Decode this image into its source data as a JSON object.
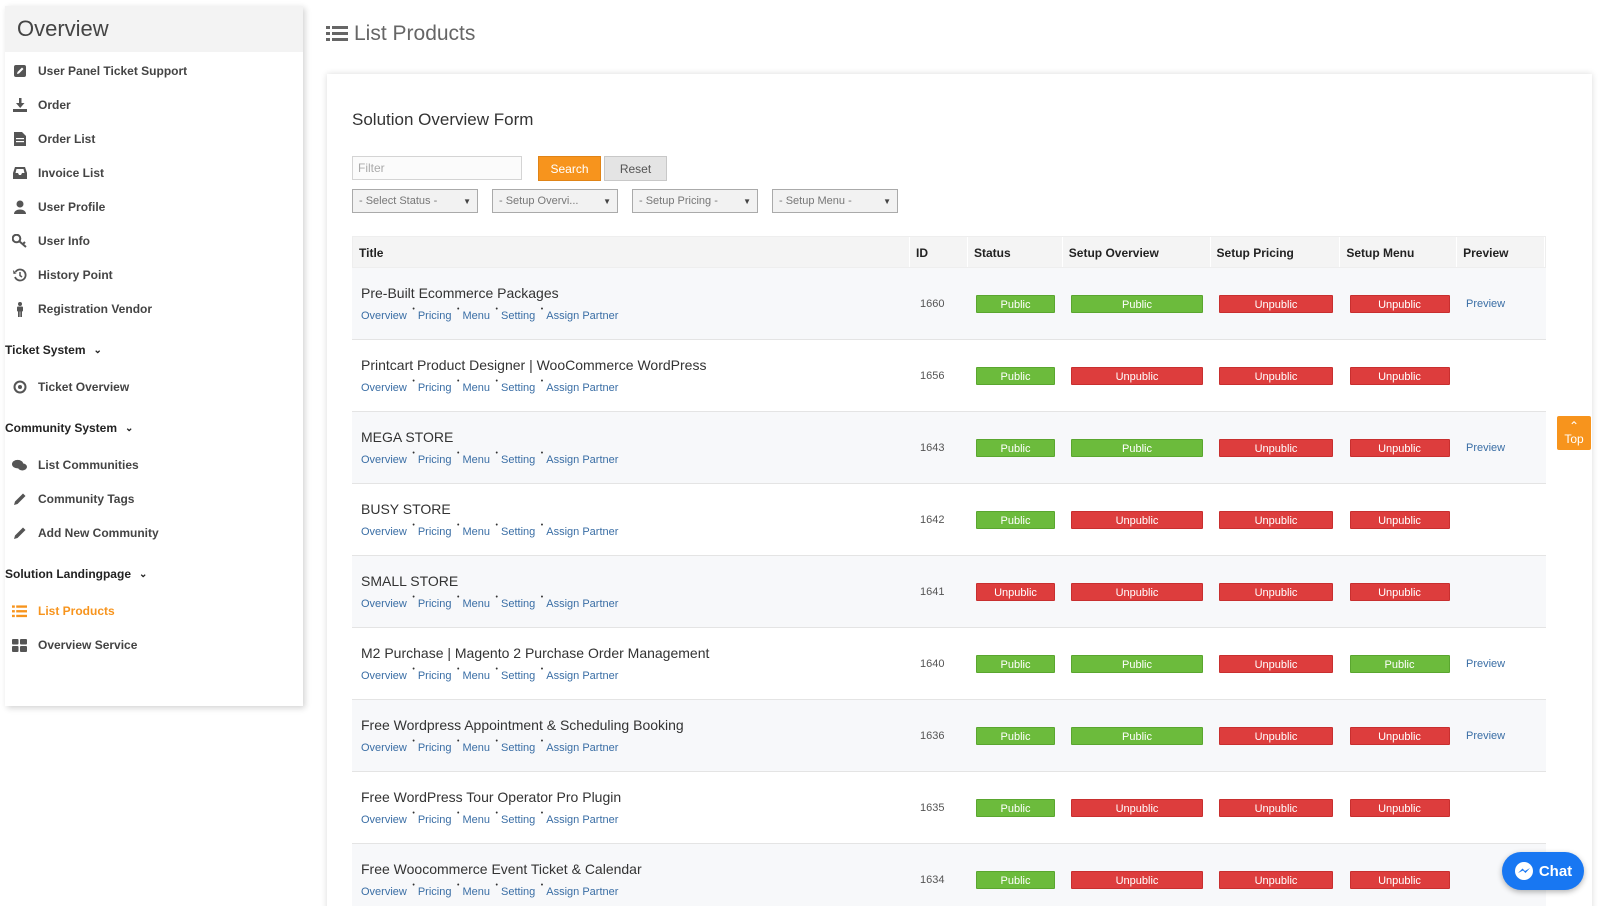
{
  "sidebar": {
    "title": "Overview",
    "items": [
      {
        "label": "User Panel Ticket Support",
        "icon": "edit-icon"
      },
      {
        "label": "Order",
        "icon": "download-icon"
      },
      {
        "label": "Order List",
        "icon": "document-icon"
      },
      {
        "label": "Invoice List",
        "icon": "inbox-icon"
      },
      {
        "label": "User Profile",
        "icon": "user-icon"
      },
      {
        "label": "User Info",
        "icon": "key-icon"
      },
      {
        "label": "History Point",
        "icon": "history-icon"
      },
      {
        "label": "Registration Vendor",
        "icon": "person-icon"
      }
    ],
    "sections": [
      {
        "label": "Ticket System",
        "items": [
          {
            "label": "Ticket Overview",
            "icon": "target-icon"
          }
        ]
      },
      {
        "label": "Community System",
        "items": [
          {
            "label": "List Communities",
            "icon": "comments-icon"
          },
          {
            "label": "Community Tags",
            "icon": "pencil-icon"
          },
          {
            "label": "Add New Community",
            "icon": "pencil-icon"
          }
        ]
      },
      {
        "label": "Solution Landingpage",
        "items": [
          {
            "label": "List Products",
            "icon": "list-icon",
            "active": true
          },
          {
            "label": "Overview Service",
            "icon": "grid-icon"
          }
        ]
      }
    ]
  },
  "page": {
    "title": "List Products"
  },
  "form": {
    "title": "Solution Overview Form",
    "filter_placeholder": "Filter",
    "search_label": "Search",
    "reset_label": "Reset",
    "selects": [
      "- Select Status -",
      "- Setup Overvi...",
      "- Setup Pricing -",
      "- Setup Menu -"
    ]
  },
  "table": {
    "headers": [
      "Title",
      "ID",
      "Status",
      "Setup Overview",
      "Setup Pricing",
      "Setup Menu",
      "Preview"
    ],
    "link_labels": [
      "Overview",
      "Pricing",
      "Menu",
      "Setting",
      "Assign Partner"
    ],
    "preview_label": "Preview",
    "rows": [
      {
        "title": "Pre-Built Ecommerce Packages",
        "id": "1660",
        "status": "Public",
        "overview": "Public",
        "pricing": "Unpublic",
        "menu": "Unpublic",
        "preview": true
      },
      {
        "title": "Printcart Product Designer | WooCommerce WordPress",
        "id": "1656",
        "status": "Public",
        "overview": "Unpublic",
        "pricing": "Unpublic",
        "menu": "Unpublic",
        "preview": false
      },
      {
        "title": "MEGA STORE",
        "id": "1643",
        "status": "Public",
        "overview": "Public",
        "pricing": "Unpublic",
        "menu": "Unpublic",
        "preview": true
      },
      {
        "title": "BUSY STORE",
        "id": "1642",
        "status": "Public",
        "overview": "Unpublic",
        "pricing": "Unpublic",
        "menu": "Unpublic",
        "preview": false
      },
      {
        "title": "SMALL STORE",
        "id": "1641",
        "status": "Unpublic",
        "overview": "Unpublic",
        "pricing": "Unpublic",
        "menu": "Unpublic",
        "preview": false
      },
      {
        "title": "M2 Purchase | Magento 2 Purchase Order Management",
        "id": "1640",
        "status": "Public",
        "overview": "Public",
        "pricing": "Unpublic",
        "menu": "Public",
        "preview": true
      },
      {
        "title": "Free Wordpress Appointment & Scheduling Booking",
        "id": "1636",
        "status": "Public",
        "overview": "Public",
        "pricing": "Unpublic",
        "menu": "Unpublic",
        "preview": true
      },
      {
        "title": "Free WordPress Tour Operator Pro Plugin",
        "id": "1635",
        "status": "Public",
        "overview": "Unpublic",
        "pricing": "Unpublic",
        "menu": "Unpublic",
        "preview": false
      },
      {
        "title": "Free Woocommerce Event Ticket & Calendar",
        "id": "1634",
        "status": "Public",
        "overview": "Unpublic",
        "pricing": "Unpublic",
        "menu": "Unpublic",
        "preview": false
      }
    ]
  },
  "floating": {
    "top_label": "Top",
    "chat_label": "Chat"
  },
  "colors": {
    "accent": "#f7941d",
    "public": "#6cbb3c",
    "unpublic": "#dd3d3d",
    "link": "#3a6ea5",
    "chat": "#1877f2"
  }
}
